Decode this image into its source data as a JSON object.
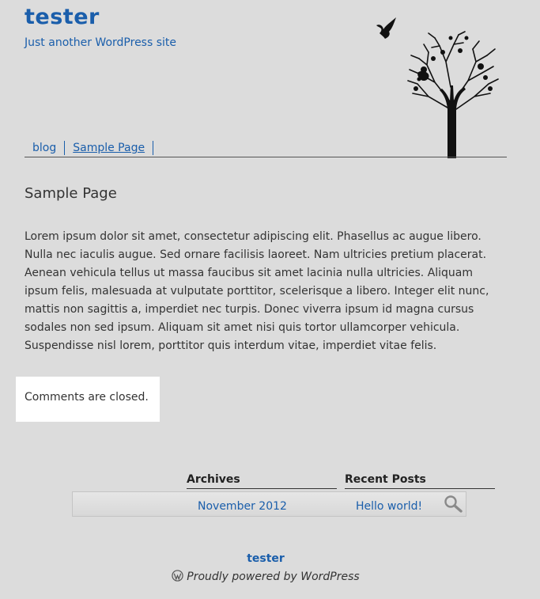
{
  "site": {
    "title": "tester",
    "tagline": "Just another WordPress site"
  },
  "nav": {
    "items": [
      {
        "label": "blog"
      },
      {
        "label": "Sample Page"
      }
    ]
  },
  "page": {
    "title": "Sample Page",
    "body": "Lorem ipsum dolor sit amet, consectetur adipiscing elit. Phasellus ac augue libero. Nulla nec iaculis augue. Sed ornare facilisis laoreet. Nam ultricies pretium placerat. Aenean vehicula tellus ut massa faucibus sit amet lacinia nulla ultricies. Aliquam ipsum felis, malesuada at vulputate porttitor, scelerisque a libero. Integer elit nunc, mattis non sagittis a, imperdiet nec turpis. Donec viverra ipsum id magna cursus sodales non sed ipsum. Aliquam sit amet nisi quis tortor ullamcorper vehicula. Suspendisse nisl lorem, porttitor quis interdum vitae, imperdiet vitae felis.",
    "comments_status": "Comments are closed."
  },
  "widgets": {
    "archives": {
      "title": "Archives",
      "items": [
        "November 2012"
      ]
    },
    "recent_posts": {
      "title": "Recent Posts",
      "items": [
        "Hello world!"
      ]
    }
  },
  "footer": {
    "site_title": "tester",
    "powered_by": "Proudly powered by WordPress"
  },
  "icons": {
    "header": "bird-and-tree-icon",
    "search": "search-icon",
    "wordpress": "wordpress-logo-icon"
  },
  "colors": {
    "background": "#dcdcdc",
    "link": "#1a5eab",
    "text": "#333333"
  }
}
